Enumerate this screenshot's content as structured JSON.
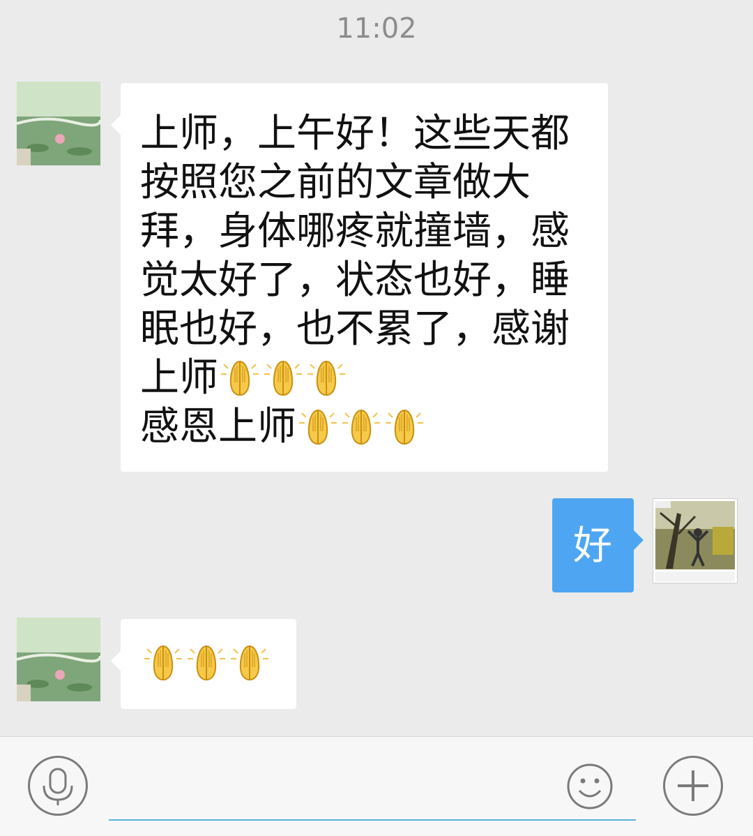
{
  "header": {
    "time": "11:02"
  },
  "messages": [
    {
      "side": "incoming",
      "text": "上师，上午好！这些天都按照您之前的文章做大拜，身体哪疼就撞墙，感觉太好了，状态也好，睡眠也好，也不累了，感谢上师",
      "emoji_after_text": 3,
      "line2_text": "感恩上师",
      "line2_emoji": 3,
      "emoji_name": "pray-hands"
    },
    {
      "side": "outgoing",
      "text": "好"
    },
    {
      "side": "incoming",
      "emoji_only": 3,
      "emoji_name": "pray-hands"
    }
  ],
  "input_bar": {
    "placeholder": "",
    "voice_icon": "microphone-icon",
    "emoji_icon": "smiley-icon",
    "more_icon": "plus-icon"
  },
  "colors": {
    "background": "#ebebeb",
    "incoming_bubble": "#ffffff",
    "outgoing_bubble": "#4ea6f2",
    "timestamp": "#8c8c8c",
    "input_underline": "#5cb0d8"
  }
}
